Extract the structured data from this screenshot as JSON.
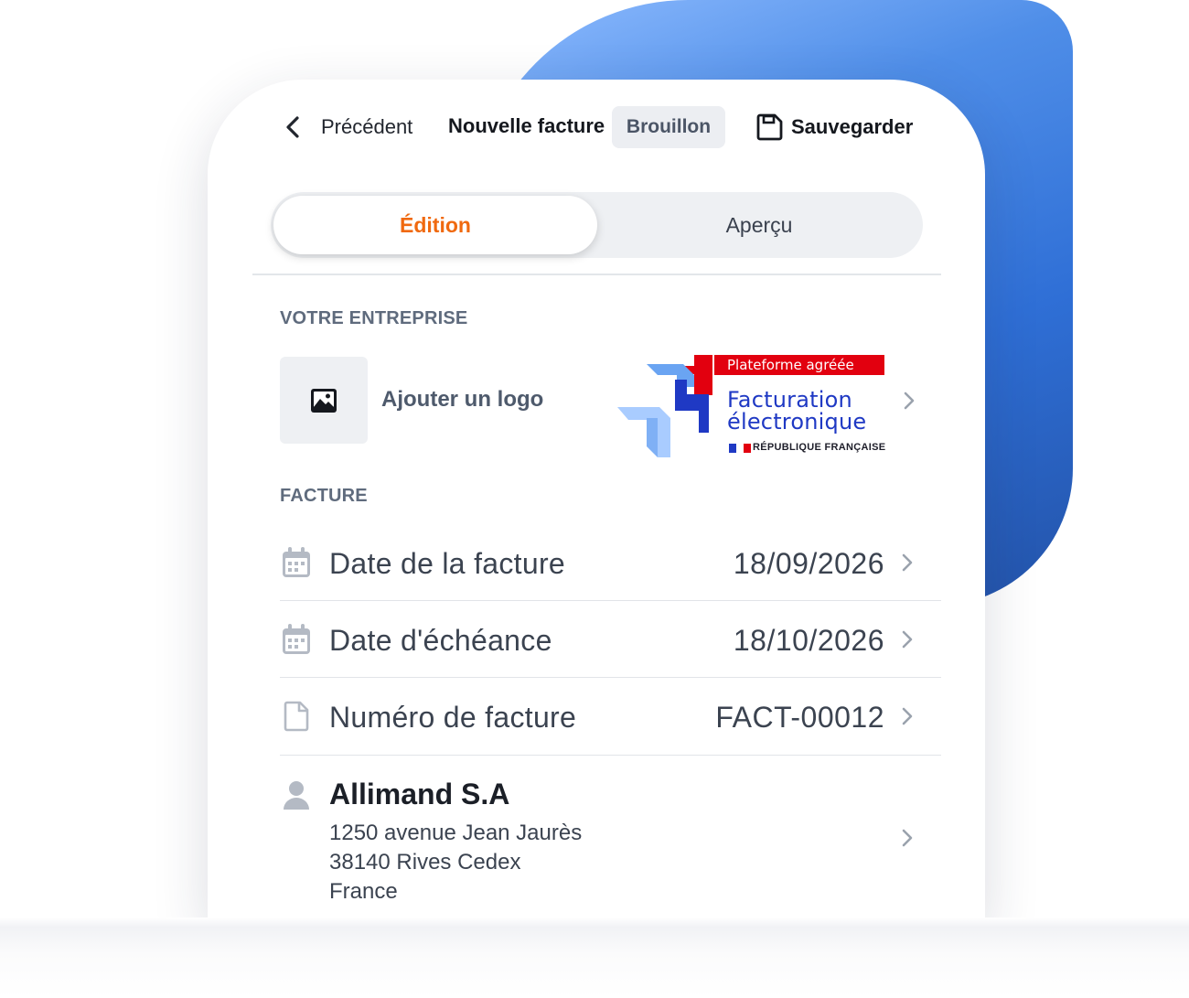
{
  "header": {
    "back_label": "Précédent",
    "title": "Nouvelle facture",
    "status": "Brouillon",
    "save_label": "Sauvegarder"
  },
  "tabs": [
    {
      "label": "Édition",
      "active": true
    },
    {
      "label": "Aperçu",
      "active": false
    }
  ],
  "company": {
    "section_label": "VOTRE ENTREPRISE",
    "add_logo_label": "Ajouter un logo",
    "badge": {
      "ribbon": "Plateforme agréée",
      "line1": "Facturation",
      "line2": "électronique",
      "republic": "RÉPUBLIQUE FRANÇAISE"
    }
  },
  "invoice": {
    "section_label": "FACTURE",
    "rows": [
      {
        "label": "Date de la facture",
        "value": "18/09/2026",
        "icon": "calendar-icon"
      },
      {
        "label": "Date d'échéance",
        "value": "18/10/2026",
        "icon": "calendar-icon"
      },
      {
        "label": "Numéro de facture",
        "value": "FACT-00012",
        "icon": "document-icon"
      }
    ]
  },
  "client": {
    "name": "Allimand S.A",
    "address": [
      "1250 avenue Jean Jaurès",
      "38140 Rives Cedex",
      "France"
    ],
    "icon": "person-icon"
  },
  "colors": {
    "accent": "#f0690f",
    "backdrop_blue": "#2f6fd6",
    "badge_red": "#e2000f",
    "badge_blue": "#1f39c4"
  }
}
